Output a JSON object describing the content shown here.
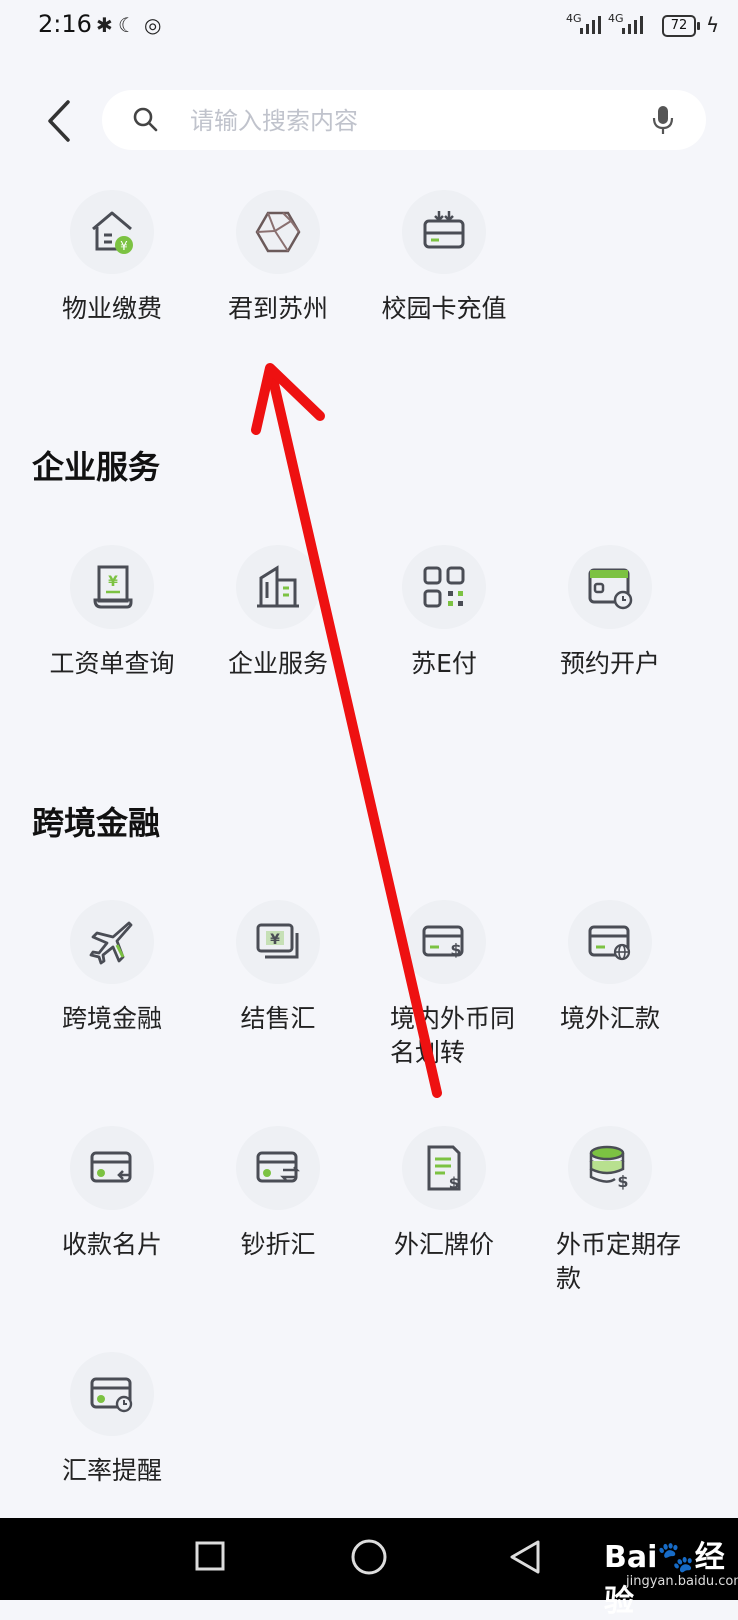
{
  "status_bar": {
    "time": "2:16",
    "signal1": "4G",
    "signal2": "4G",
    "battery": "72"
  },
  "search": {
    "placeholder": "请输入搜索内容"
  },
  "top_items": [
    {
      "label": "物业缴费",
      "icon": "property-fee-icon"
    },
    {
      "label": "君到苏州",
      "icon": "suzhou-icon"
    },
    {
      "label": "校园卡充值",
      "icon": "campus-card-icon"
    }
  ],
  "sections": [
    {
      "title": "企业服务",
      "items": [
        {
          "label": "工资单查询",
          "icon": "payslip-icon"
        },
        {
          "label": "企业服务",
          "icon": "building-icon"
        },
        {
          "label": "苏E付",
          "icon": "qr-code-icon"
        },
        {
          "label": "预约开户",
          "icon": "appointment-icon"
        }
      ]
    },
    {
      "title": "跨境金融",
      "items": [
        {
          "label": "跨境金融",
          "icon": "airplane-icon"
        },
        {
          "label": "结售汇",
          "icon": "exchange-bill-icon"
        },
        {
          "label": "境内外币同名划转",
          "icon": "card-dollar-icon"
        },
        {
          "label": "境外汇款",
          "icon": "card-globe-icon"
        },
        {
          "label": "收款名片",
          "icon": "card-receive-icon"
        },
        {
          "label": "钞折汇",
          "icon": "card-transfer-icon"
        },
        {
          "label": "外汇牌价",
          "icon": "rate-list-icon"
        },
        {
          "label": "外币定期存款",
          "icon": "coin-stack-icon"
        },
        {
          "label": "汇率提醒",
          "icon": "card-clock-icon"
        }
      ]
    }
  ],
  "watermark": {
    "brand": "Bai",
    "brand2": "经验",
    "url": "jingyan.baidu.com"
  },
  "colors": {
    "accent_green": "#7cc242",
    "icon_dark": "#4a4d55",
    "arrow_red": "#ee1111"
  }
}
